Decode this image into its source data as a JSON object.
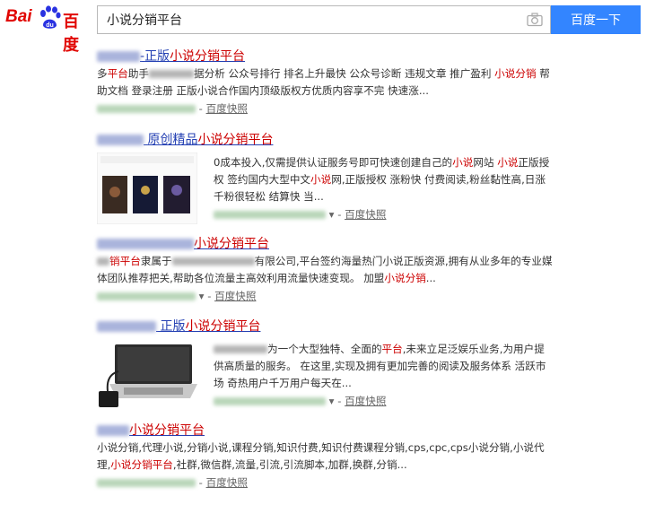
{
  "logo": {
    "latin": "Bai",
    "paw_text": "du",
    "chinese": "百度"
  },
  "search": {
    "query": "小说分销平台",
    "button": "百度一下"
  },
  "snapshot_label": "百度快照",
  "results": [
    {
      "title": [
        "正版",
        "小说分销平台"
      ],
      "abstract": [
        "多",
        "平台",
        "助手",
        "据分析 公众号排行 排名上升最快 公众号诊断 违规文章 推广盈利 ",
        "小说分销",
        " 帮助文档 登录注册 正版小说合作国内顶级版权方优质内容享不完 快速涨..."
      ]
    },
    {
      "title": [
        "原创精品",
        "小说分销平台"
      ],
      "abstract": [
        "0成本投入,仅需提供认证服务号即可快速创建自己的",
        "小说",
        "网站 ",
        "小说",
        "正版授权 签约国内大型中文",
        "小说",
        "网,正版授权 涨粉快 付费阅读,粉丝黏性高,日涨千粉很轻松 结算快 当..."
      ]
    },
    {
      "title": [
        "小说分销平台"
      ],
      "abstract": [
        "销平台",
        "隶属于",
        "有限公司,平台签约海量热门小说正版资源,拥有从业多年的专业媒体团队推荐把关,帮助各位流量主高效利用流量快速变现。 加盟",
        "小说分销",
        "..."
      ]
    },
    {
      "title": [
        "正版",
        "小说分销平台"
      ],
      "abstract": [
        "为一个大型独特、全面的",
        "平台",
        ",未来立足泛娱乐业务,为用户提供高质量的服务。 在这里,实现及拥有更加完善的阅读及服务体系 活跃市场 奇热用户千万用户每天在..."
      ]
    },
    {
      "title": [
        "小说分销平台"
      ],
      "abstract": [
        "小说分销,代理小说,分销小说,课程分销,知识付费,知识付费课程分销,cps,cpc,cps小说分销,小说代理,",
        "小说分销平台",
        ",社群,微信群,流量,引流,引流脚本,加群,换群,分销..."
      ]
    }
  ]
}
